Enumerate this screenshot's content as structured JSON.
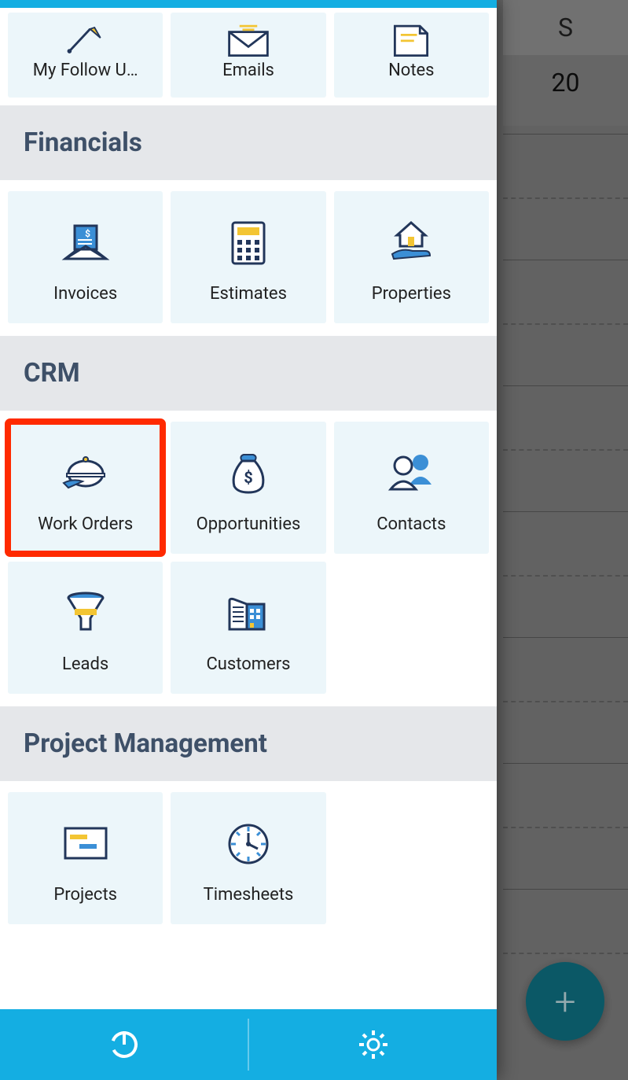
{
  "calendar": {
    "day_letter": "S",
    "day_number": "20"
  },
  "fab": {
    "glyph": "+"
  },
  "sections": {
    "top_items": [
      {
        "label": "My Follow U…",
        "icon": "pin"
      },
      {
        "label": "Emails",
        "icon": "envelope"
      },
      {
        "label": "Notes",
        "icon": "note"
      }
    ],
    "financials": {
      "title": "Financials",
      "items": [
        {
          "label": "Invoices",
          "icon": "invoice"
        },
        {
          "label": "Estimates",
          "icon": "calculator"
        },
        {
          "label": "Properties",
          "icon": "house-hand"
        }
      ]
    },
    "crm": {
      "title": "CRM",
      "items": [
        {
          "label": "Work Orders",
          "icon": "serve",
          "highlight": true
        },
        {
          "label": "Opportunities",
          "icon": "money-bag"
        },
        {
          "label": "Contacts",
          "icon": "people"
        },
        {
          "label": "Leads",
          "icon": "funnel"
        },
        {
          "label": "Customers",
          "icon": "buildings"
        }
      ]
    },
    "pm": {
      "title": "Project Management",
      "items": [
        {
          "label": "Projects",
          "icon": "gantt"
        },
        {
          "label": "Timesheets",
          "icon": "clock"
        }
      ]
    }
  },
  "bottom": {
    "left_icon": "power",
    "right_icon": "gear"
  },
  "colors": {
    "accent": "#14aee2",
    "dark": "#22365a",
    "gold": "#f3c533",
    "tile_bg": "#ecf6fa",
    "header_bg": "#e5e7ea",
    "highlight": "#ff2a00"
  }
}
